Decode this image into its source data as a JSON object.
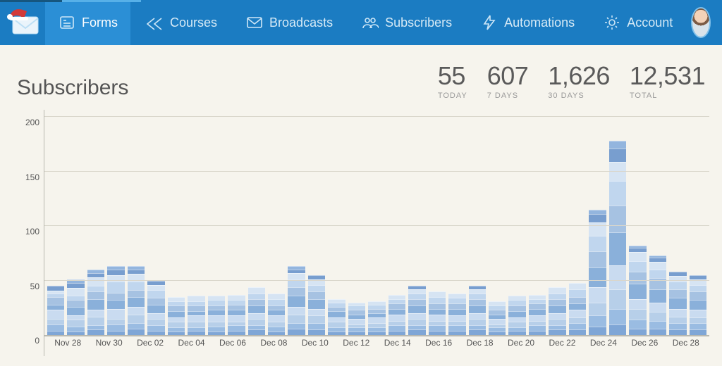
{
  "nav": {
    "items": [
      {
        "id": "forms",
        "label": "Forms"
      },
      {
        "id": "courses",
        "label": "Courses"
      },
      {
        "id": "broadcasts",
        "label": "Broadcasts"
      },
      {
        "id": "subscribers",
        "label": "Subscribers"
      },
      {
        "id": "automations",
        "label": "Automations"
      },
      {
        "id": "account",
        "label": "Account"
      }
    ]
  },
  "page": {
    "title": "Subscribers"
  },
  "stats": {
    "today": {
      "value": "55",
      "label": "TODAY"
    },
    "week": {
      "value": "607",
      "label": "7 DAYS"
    },
    "month": {
      "value": "1,626",
      "label": "30 DAYS"
    },
    "total": {
      "value": "12,531",
      "label": "TOTAL"
    }
  },
  "chart": {
    "ymax": 200,
    "yticks": [
      0,
      50,
      100,
      150,
      200
    ],
    "xlabels": [
      "Nov 28",
      "Nov 30",
      "Dec 02",
      "Dec 04",
      "Dec 06",
      "Dec 08",
      "Dec 10",
      "Dec 12",
      "Dec 14",
      "Dec 16",
      "Dec 18",
      "Dec 20",
      "Dec 22",
      "Dec 24",
      "Dec 26",
      "Dec 28"
    ],
    "palette": {
      "a": "#7fa6d6",
      "b": "#9abce2",
      "c": "#b7cfe9",
      "d": "#c9dbf0",
      "e": "#8ab0da",
      "f": "#a6c2e2",
      "g": "#c0d6ee",
      "h": "#d6e4f3",
      "i": "#789ecf",
      "j": "#93b5de"
    }
  },
  "chart_data": {
    "type": "bar",
    "title": "Subscribers",
    "xlabel": "",
    "ylabel": "",
    "ylim": [
      0,
      200
    ],
    "stacked": true,
    "categories": [
      "Nov 28",
      "Nov 29",
      "Nov 30",
      "Dec 01",
      "Dec 02",
      "Dec 03",
      "Dec 04",
      "Dec 05",
      "Dec 06",
      "Dec 07",
      "Dec 08",
      "Dec 09",
      "Dec 10",
      "Dec 11",
      "Dec 12",
      "Dec 13",
      "Dec 14",
      "Dec 15",
      "Dec 16",
      "Dec 17",
      "Dec 18",
      "Dec 19",
      "Dec 20",
      "Dec 21",
      "Dec 22",
      "Dec 23",
      "Dec 24",
      "Dec 25",
      "Dec 26",
      "Dec 27",
      "Dec 28"
    ],
    "values": [
      45,
      51,
      60,
      63,
      63,
      50,
      35,
      36,
      36,
      37,
      44,
      38,
      63,
      55,
      33,
      30,
      31,
      37,
      45,
      40,
      38,
      45,
      31,
      36,
      37,
      44,
      48,
      115,
      178,
      82,
      73,
      58,
      55
    ],
    "note": "Each daily bar is a stack of multiple subscription sources (segments). Only totals are readable from the chart; segment compositions below are visual estimates and sum to the total.",
    "segments_estimate": [
      [
        4,
        6,
        5,
        8,
        5,
        7,
        3,
        3,
        4
      ],
      [
        3,
        5,
        6,
        4,
        8,
        6,
        4,
        7,
        5,
        3
      ],
      [
        5,
        4,
        8,
        6,
        10,
        7,
        5,
        8,
        4,
        3
      ],
      [
        4,
        6,
        5,
        9,
        8,
        7,
        10,
        6,
        5,
        3
      ],
      [
        6,
        5,
        8,
        7,
        9,
        6,
        8,
        7,
        4,
        3
      ],
      [
        4,
        5,
        6,
        5,
        8,
        6,
        7,
        5,
        4
      ],
      [
        3,
        4,
        5,
        4,
        6,
        5,
        4,
        4
      ],
      [
        4,
        3,
        5,
        6,
        4,
        5,
        4,
        5
      ],
      [
        3,
        5,
        4,
        6,
        5,
        4,
        5,
        4
      ],
      [
        4,
        5,
        3,
        6,
        5,
        5,
        4,
        5
      ],
      [
        5,
        4,
        6,
        5,
        7,
        6,
        5,
        6
      ],
      [
        3,
        5,
        4,
        6,
        5,
        4,
        6,
        5
      ],
      [
        6,
        5,
        8,
        7,
        10,
        8,
        7,
        6,
        3,
        3
      ],
      [
        5,
        6,
        7,
        6,
        9,
        7,
        6,
        5,
        4
      ],
      [
        3,
        4,
        5,
        4,
        6,
        4,
        4,
        3
      ],
      [
        3,
        4,
        3,
        5,
        4,
        4,
        4,
        3
      ],
      [
        3,
        4,
        4,
        5,
        4,
        4,
        4,
        3
      ],
      [
        4,
        5,
        4,
        6,
        5,
        5,
        4,
        4
      ],
      [
        5,
        4,
        6,
        5,
        7,
        6,
        5,
        4,
        3
      ],
      [
        4,
        5,
        4,
        6,
        5,
        5,
        6,
        5
      ],
      [
        4,
        5,
        4,
        5,
        6,
        5,
        5,
        4
      ],
      [
        5,
        4,
        6,
        5,
        7,
        6,
        5,
        4,
        3
      ],
      [
        3,
        4,
        3,
        5,
        4,
        4,
        4,
        4
      ],
      [
        4,
        3,
        5,
        4,
        6,
        5,
        5,
        4
      ],
      [
        4,
        5,
        4,
        5,
        6,
        5,
        4,
        4
      ],
      [
        5,
        4,
        6,
        5,
        7,
        6,
        5,
        6
      ],
      [
        5,
        6,
        5,
        7,
        6,
        6,
        7,
        6
      ],
      [
        8,
        10,
        12,
        14,
        18,
        15,
        14,
        12,
        8,
        4
      ],
      [
        10,
        14,
        18,
        22,
        30,
        25,
        22,
        18,
        12,
        7
      ],
      [
        6,
        8,
        10,
        9,
        14,
        11,
        10,
        8,
        4,
        2
      ],
      [
        6,
        7,
        8,
        9,
        12,
        10,
        8,
        7,
        4,
        2
      ],
      [
        5,
        6,
        6,
        7,
        10,
        8,
        7,
        5,
        4
      ],
      [
        5,
        6,
        5,
        7,
        9,
        8,
        6,
        5,
        4
      ]
    ]
  }
}
